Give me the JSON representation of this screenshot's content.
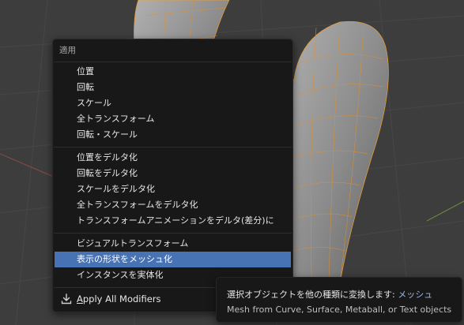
{
  "menu": {
    "title": "適用",
    "groups": [
      [
        "位置",
        "回転",
        "スケール",
        "全トランスフォーム",
        "回転・スケール"
      ],
      [
        "位置をデルタ化",
        "回転をデルタ化",
        "スケールをデルタ化",
        "全トランスフォームをデルタ化",
        "トランスフォームアニメーションをデルタ(差分)に"
      ],
      [
        "ビジュアルトランスフォーム",
        "表示の形状をメッシュ化",
        "インスタンスを実体化"
      ]
    ],
    "highlighted_item": "表示の形状をメッシュ化",
    "apply_all": {
      "accel": "A",
      "rest": "pply All Modifiers",
      "icon": "download-arrow-icon"
    }
  },
  "tooltip": {
    "description": "選択オブジェクトを他の種類に変換します:",
    "value": "メッシュ",
    "detail": "Mesh from Curve, Surface, Metaball, or Text objects"
  },
  "colors": {
    "menu_bg": "#181818",
    "highlight": "#4772b3",
    "wire_orange": "#f0a030",
    "mesh_gray": "#8a8a8a",
    "viewport_bg": "#3d3d3d"
  }
}
